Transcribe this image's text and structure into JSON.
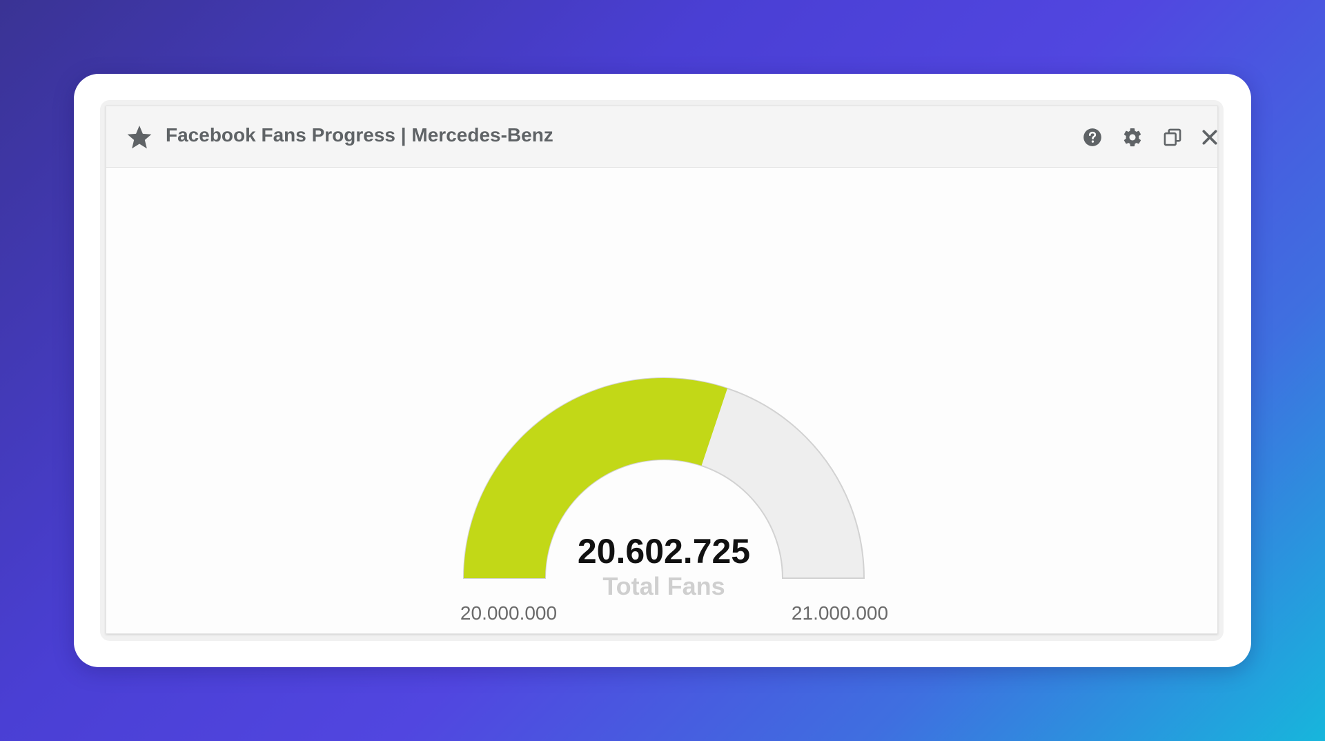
{
  "widget": {
    "title": "Facebook Fans Progress | Mercedes-Benz",
    "title_icon": "star-icon",
    "header_buttons": [
      {
        "icon": "help-icon",
        "label": "Help"
      },
      {
        "icon": "gear-icon",
        "label": "Settings"
      },
      {
        "icon": "copy-icon",
        "label": "Duplicate"
      },
      {
        "icon": "close-icon",
        "label": "Close"
      }
    ]
  },
  "chart_data": {
    "type": "gauge",
    "value": 20602725,
    "min": 20000000,
    "max": 21000000,
    "value_label": "20.602.725",
    "caption": "Total Fans",
    "min_label": "20.000.000",
    "max_label": "21.000.000",
    "colors": {
      "fill": "#c2d817",
      "track": "#eeeeee",
      "track_border": "#d2d2d2"
    }
  }
}
